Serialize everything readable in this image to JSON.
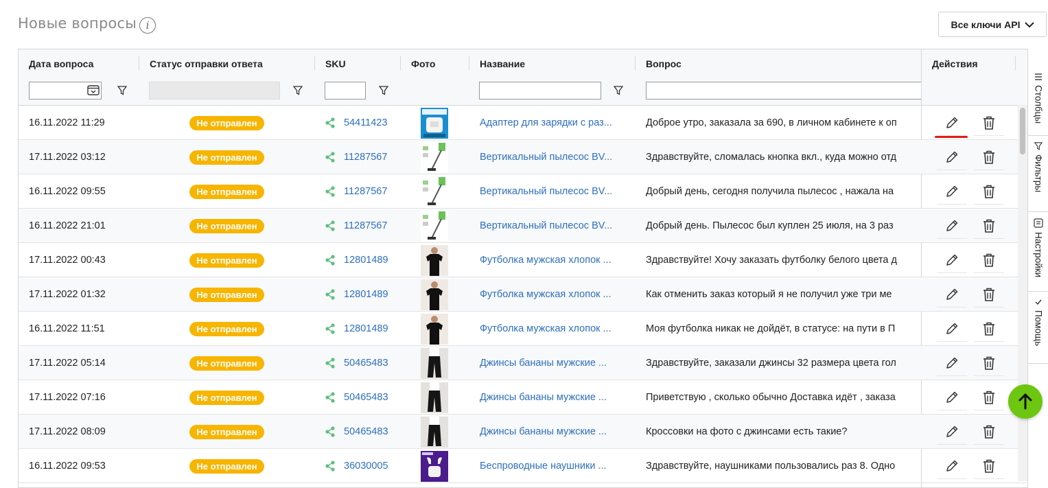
{
  "header": {
    "title": "Новые вопросы",
    "info_icon": "i",
    "api_select": {
      "label": "Все ключи API",
      "icon": "chevron-down-icon"
    }
  },
  "table": {
    "columns": [
      "Дата вопроса",
      "Статус отправки ответа",
      "SKU",
      "Фото",
      "Название",
      "Вопрос",
      "Действия"
    ],
    "rows": [
      {
        "date": "16.11.2022 11:29",
        "status": "Не отправлен",
        "sku": "54411423",
        "photo": "charger",
        "name": "Адаптер для зарядки с раз...",
        "question": "Доброе утро, заказала за 690, в личном кабинете к оп"
      },
      {
        "date": "17.11.2022 03:12",
        "status": "Не отправлен",
        "sku": "11287567",
        "photo": "vacuum",
        "name": "Вертикальный пылесос BV...",
        "question": "Здравствуйте, сломалась кнопка вкл., куда можно отд"
      },
      {
        "date": "16.11.2022 09:55",
        "status": "Не отправлен",
        "sku": "11287567",
        "photo": "vacuum",
        "name": "Вертикальный пылесос BV...",
        "question": "Добрый день, сегодня получила пылесос , нажала на"
      },
      {
        "date": "16.11.2022 21:01",
        "status": "Не отправлен",
        "sku": "11287567",
        "photo": "vacuum",
        "name": "Вертикальный пылесос BV...",
        "question": "Добрый день. Пылесос был куплен 25 июля, на 3 раз"
      },
      {
        "date": "17.11.2022 00:43",
        "status": "Не отправлен",
        "sku": "12801489",
        "photo": "tshirt",
        "name": "Футболка мужская хлопок ...",
        "question": "Здравствуйте! Хочу заказать футболку белого цвета д"
      },
      {
        "date": "17.11.2022 01:32",
        "status": "Не отправлен",
        "sku": "12801489",
        "photo": "tshirt",
        "name": "Футболка мужская хлопок ...",
        "question": "Как отменить заказ который я не получил уже три ме"
      },
      {
        "date": "16.11.2022 11:51",
        "status": "Не отправлен",
        "sku": "12801489",
        "photo": "tshirt",
        "name": "Футболка мужская хлопок ...",
        "question": "Моя футболка никак не дойдёт, в статусе: на пути в П"
      },
      {
        "date": "17.11.2022 05:14",
        "status": "Не отправлен",
        "sku": "50465483",
        "photo": "jeans",
        "name": "Джинсы бананы мужские ...",
        "question": "Здравствуйте, заказали джинсы 32 размера цвета гол"
      },
      {
        "date": "17.11.2022 07:16",
        "status": "Не отправлен",
        "sku": "50465483",
        "photo": "jeans",
        "name": "Джинсы бананы мужские ...",
        "question": "Приветствую , сколько обычно Доставка идёт , заказа"
      },
      {
        "date": "17.11.2022 08:09",
        "status": "Не отправлен",
        "sku": "50465483",
        "photo": "jeans",
        "name": "Джинсы бананы мужские ...",
        "question": "Кроссовки на фото с джинсами есть такие?"
      },
      {
        "date": "16.11.2022 09:53",
        "status": "Не отправлен",
        "sku": "36030005",
        "photo": "earbuds",
        "name": "Беспроводные наушники ...",
        "question": "Здравствуйте, наушниками пользовались раз 8. Одно"
      }
    ]
  },
  "side_panel": {
    "tabs": [
      {
        "label": "Столбцы",
        "icon": "columns-icon"
      },
      {
        "label": "Фильтры",
        "icon": "filter-icon"
      },
      {
        "label": "Настройки",
        "icon": "settings-list-icon"
      },
      {
        "label": "Помощь",
        "icon": "check-icon"
      }
    ]
  },
  "colors": {
    "badge": "#f7b500",
    "link": "#2d6fc0",
    "fab": "#6dc60f",
    "highlight": "#e21b1b"
  }
}
